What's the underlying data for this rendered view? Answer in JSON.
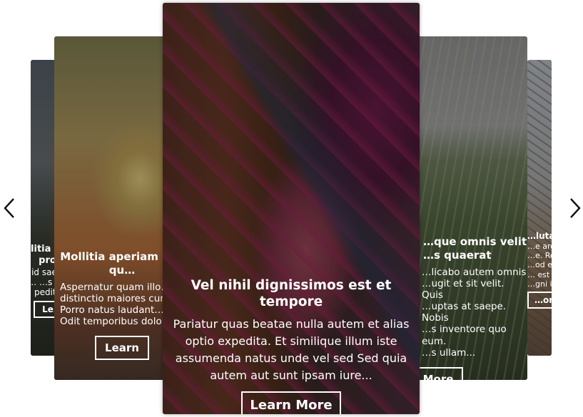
{
  "carousel": {
    "cards": [
      {
        "title": "…litia in a… pro…",
        "desc": "…id sae… …s quo… …s solu… …pedita…",
        "button": "Le…"
      },
      {
        "title": "Mollitia aperiam m… qu…",
        "desc_lines": [
          "Aspernatur quam illo…",
          "distinctio maiores cum…",
          "Porro natus laudant…",
          "Odit temporibus dolo…"
        ],
        "button": "Learn"
      },
      {
        "title": "Vel nihil dignissimos est et tempore",
        "desc": "Pariatur quas beatae nulla autem et alias optio expedita. Et similique illum iste assumenda natus unde vel sed Sed quia autem aut sunt ipsam iure...",
        "button": "Learn More"
      },
      {
        "title_lines": [
          "…que omnis velit",
          "…s quaerat"
        ],
        "desc_lines": [
          "…licabo autem omnis",
          "…ugit et sit velit. Quis",
          "…uptas at saepe. Nobis",
          "…s inventore quo eum.",
          "…s ullam..."
        ],
        "button": "More"
      },
      {
        "title": "…luta …",
        "desc_lines": [
          "…e arch…",
          "…e. Rep…",
          "…od ea…",
          "… est d…",
          "…gni in…"
        ],
        "button": "…ore"
      }
    ],
    "prev_icon": "chevron-left-icon",
    "next_icon": "chevron-right-icon"
  }
}
